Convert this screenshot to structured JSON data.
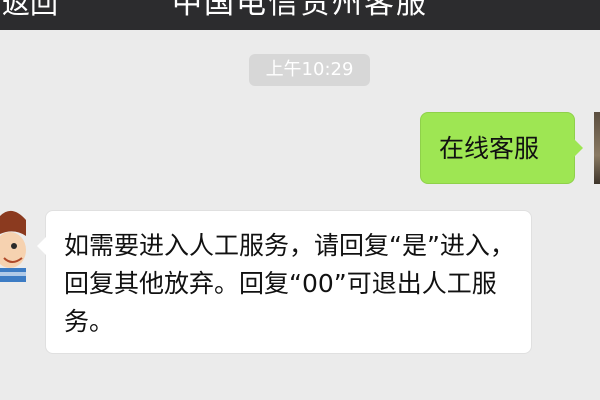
{
  "nav": {
    "back_label": "返回",
    "title": "中国电信贵州客服"
  },
  "chat": {
    "timestamp": "上午10:29",
    "messages": [
      {
        "direction": "out",
        "text": "在线客服"
      },
      {
        "direction": "in",
        "text": "如需要进入人工服务，请回复“是”进入，回复其他放弃。回复“00”可退出人工服务。"
      }
    ]
  },
  "colors": {
    "nav_background": "#2c2c2e",
    "chat_background": "#ebebeb",
    "outgoing_bubble": "#9ee653",
    "incoming_bubble": "#ffffff"
  }
}
